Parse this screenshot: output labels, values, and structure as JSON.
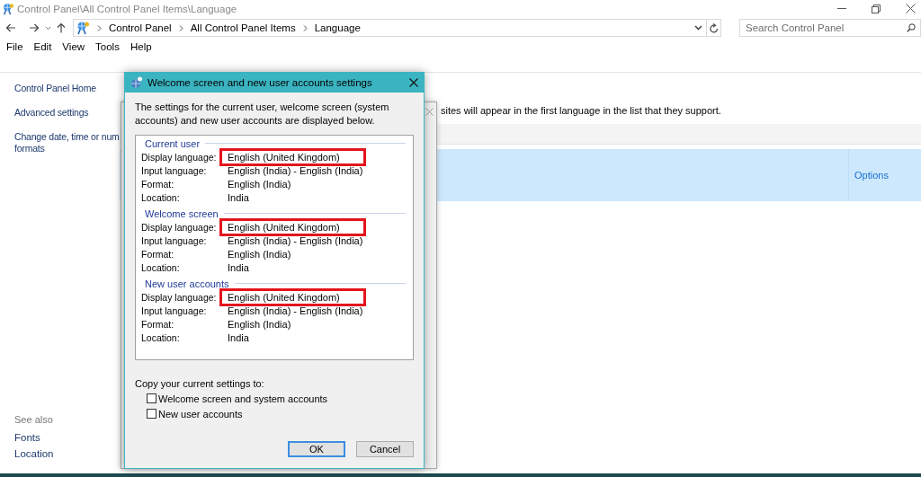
{
  "window": {
    "title": "Control Panel\\All Control Panel Items\\Language"
  },
  "address_bar": {
    "breadcrumbs": [
      "Control Panel",
      "All Control Panel Items",
      "Language"
    ]
  },
  "search": {
    "placeholder": "Search Control Panel"
  },
  "menu": [
    "File",
    "Edit",
    "View",
    "Tools",
    "Help"
  ],
  "sidebar": {
    "links": [
      "Control Panel Home",
      "Advanced settings",
      "Change date, time or num\nformats"
    ],
    "see_also_title": "See also",
    "see_also": [
      "Fonts",
      "Location"
    ]
  },
  "main": {
    "description": "sites will appear in the first language in the list that they support.",
    "language_row": {
      "selected": true,
      "options_link": "Options"
    }
  },
  "dialog": {
    "title": "Welcome screen and new user accounts settings",
    "intro": "The settings for the current user, welcome screen (system accounts) and new user accounts are displayed below.",
    "groups": [
      {
        "title": "Current user",
        "rows": [
          {
            "label": "Display language:",
            "value": "English (United Kingdom)",
            "highlighted": true
          },
          {
            "label": "Input language:",
            "value": "English (India) - English (India)",
            "highlighted": false
          },
          {
            "label": "Format:",
            "value": "English (India)",
            "highlighted": false
          },
          {
            "label": "Location:",
            "value": "India",
            "highlighted": false
          }
        ]
      },
      {
        "title": "Welcome screen",
        "rows": [
          {
            "label": "Display language:",
            "value": "English (United Kingdom)",
            "highlighted": true
          },
          {
            "label": "Input language:",
            "value": "English (India) - English (India)",
            "highlighted": false
          },
          {
            "label": "Format:",
            "value": "English (India)",
            "highlighted": false
          },
          {
            "label": "Location:",
            "value": "India",
            "highlighted": false
          }
        ]
      },
      {
        "title": "New user accounts",
        "rows": [
          {
            "label": "Display language:",
            "value": "English (United Kingdom)",
            "highlighted": true
          },
          {
            "label": "Input language:",
            "value": "English (India) - English (India)",
            "highlighted": false
          },
          {
            "label": "Format:",
            "value": "English (India)",
            "highlighted": false
          },
          {
            "label": "Location:",
            "value": "India",
            "highlighted": false
          }
        ]
      }
    ],
    "copy_title": "Copy your current settings to:",
    "checkboxes": [
      {
        "label": "Welcome screen and system accounts",
        "checked": false
      },
      {
        "label": "New user accounts",
        "checked": false
      }
    ],
    "buttons": [
      {
        "label": "OK",
        "default": true
      },
      {
        "label": "Cancel",
        "default": false
      }
    ]
  }
}
